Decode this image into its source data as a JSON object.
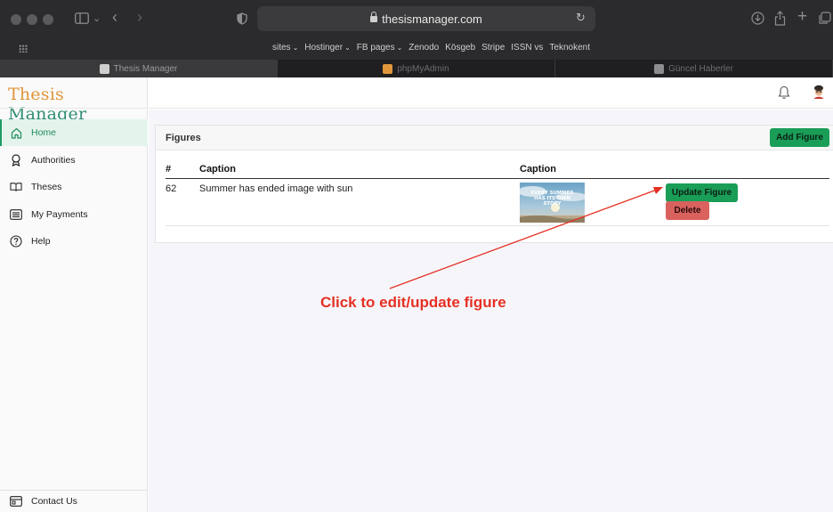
{
  "browser": {
    "url": "thesismanager.com",
    "bookmarks": [
      {
        "label": "sites",
        "dropdown": true
      },
      {
        "label": "Hostinger",
        "dropdown": true
      },
      {
        "label": "FB pages",
        "dropdown": true
      },
      {
        "label": "Zenodo",
        "dropdown": false
      },
      {
        "label": "Kösgeb",
        "dropdown": false
      },
      {
        "label": "Stripe",
        "dropdown": false
      },
      {
        "label": "ISSN vs",
        "dropdown": false
      },
      {
        "label": "Teknokent",
        "dropdown": false
      }
    ],
    "tabs": [
      {
        "label": "Thesis Manager",
        "active": true,
        "favicon_color": "#cfcfcf"
      },
      {
        "label": "phpMyAdmin",
        "active": false,
        "favicon_color": "#e0963a"
      },
      {
        "label": "Güncel Haberler",
        "active": false,
        "favicon_color": "#8d8c8e"
      }
    ]
  },
  "app": {
    "brand_part1": "Thesis",
    "brand_part2": "Manager",
    "colors": {
      "brand_orange": "#e0963a",
      "brand_green": "#2f8d73",
      "accent_green": "#1a9d57",
      "danger": "#d9625f",
      "annotation_red": "#e53024"
    }
  },
  "sidebar": {
    "items": [
      {
        "label": "Home",
        "icon": "home-icon",
        "active": true
      },
      {
        "label": "Authorities",
        "icon": "award-icon",
        "active": false
      },
      {
        "label": "Theses",
        "icon": "book-icon",
        "active": false
      },
      {
        "label": "My Payments",
        "icon": "list-icon",
        "active": false
      },
      {
        "label": "Help",
        "icon": "help-icon",
        "active": false
      }
    ],
    "contact_label": "Contact Us"
  },
  "figures": {
    "title": "Figures",
    "add_button": "Add Figure",
    "columns": [
      "#",
      "Caption",
      "Caption"
    ],
    "rows": [
      {
        "id": "62",
        "caption": "Summer has ended image with sun",
        "thumbnail_text": [
          "EVERY SUMMER",
          "HAS ITS OWN",
          "STORY"
        ],
        "update_label": "Update Figure",
        "delete_label": "Delete"
      }
    ]
  },
  "annotation": {
    "text": "Click to edit/update figure"
  }
}
